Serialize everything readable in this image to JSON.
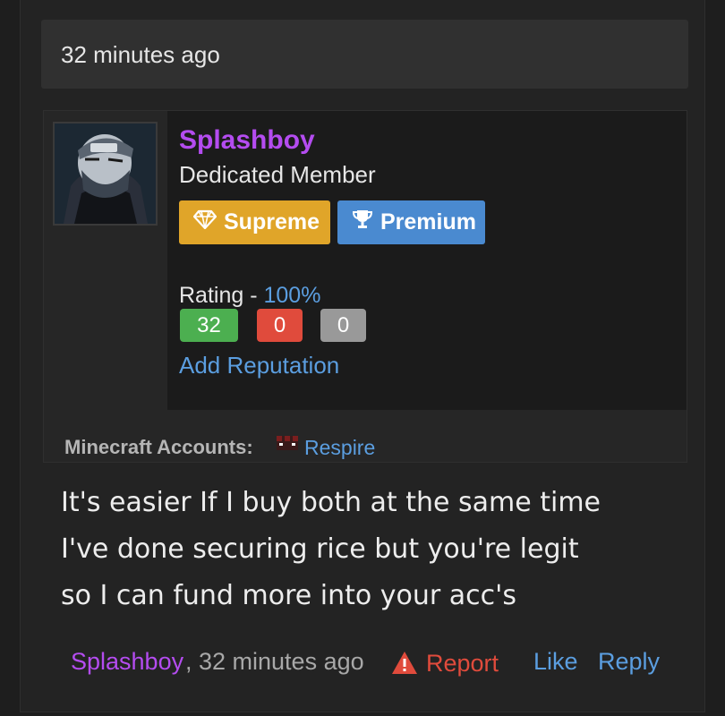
{
  "post": {
    "time_header": "32 minutes ago",
    "author": {
      "username": "Splashboy",
      "title": "Dedicated Member",
      "badges": [
        {
          "label": "Supreme",
          "icon": "diamond-icon",
          "color": "#e0a529"
        },
        {
          "label": "Premium",
          "icon": "trophy-icon",
          "color": "#4a8ad0"
        }
      ],
      "rating_label": "Rating - ",
      "rating_percent": "100%",
      "reputation": {
        "positive": "32",
        "negative": "0",
        "neutral": "0"
      },
      "add_reputation": "Add Reputation",
      "minecraft_label": "Minecraft Accounts:",
      "minecraft_account": "Respire"
    },
    "message_lines": [
      "It's easier If I buy both at the same time",
      "I've done securing rice but you're legit",
      "so I can fund more into your acc's"
    ],
    "footer": {
      "author": "Splashboy",
      "time": ", 32 minutes ago",
      "report": "Report",
      "like": "Like",
      "reply": "Reply"
    }
  },
  "colors": {
    "username": "#b44cf0",
    "link": "#5b9ee0",
    "report": "#e04b3c",
    "rep_positive": "#4caf50",
    "rep_negative": "#e04b3c",
    "rep_neutral": "#999999"
  }
}
